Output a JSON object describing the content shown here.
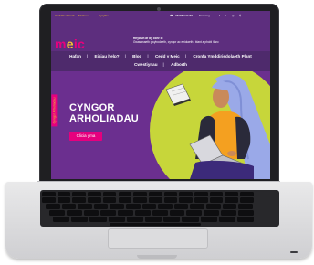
{
  "site": {
    "top_links": [
      "Ymddiriedolaeth",
      "Melinau",
      "Cysylltu"
    ],
    "phone": "08088 023456",
    "language_toggle": "Saesneg",
    "logo": {
      "prefix": "m",
      "accent": "e",
      "suffix": "ic"
    },
    "tagline": {
      "line1": "Rhywun ar dy ochr di",
      "line2": "Gwasanaeth gwybodaeth, cyngor ac eiriolaeth i blant a phobl ifanc"
    },
    "nav": {
      "row1": [
        "Hafan",
        "Eisiau help?",
        "Blog",
        "Cedd y Meic",
        "Cronfa Ymddiriedolaeth Plant"
      ],
      "row2": [
        "Cwestiynau",
        "Adborth"
      ]
    },
    "hero": {
      "side_tag": "Cyngor Arholiadau",
      "title_line1": "CYNGOR",
      "title_line2": "ARHOLIADAU",
      "button": "Clicia yma"
    }
  },
  "colors": {
    "purple": "#5d2e7e",
    "nav_purple": "#4e2a6c",
    "hero_purple": "#6b2f8f",
    "magenta": "#e6007e",
    "yellow": "#f4c430",
    "lime": "#c7d63a"
  },
  "icons": [
    "phone-icon",
    "facebook-icon",
    "twitter-icon",
    "instagram-icon",
    "search-icon",
    "book-icon",
    "laptop-icon"
  ]
}
